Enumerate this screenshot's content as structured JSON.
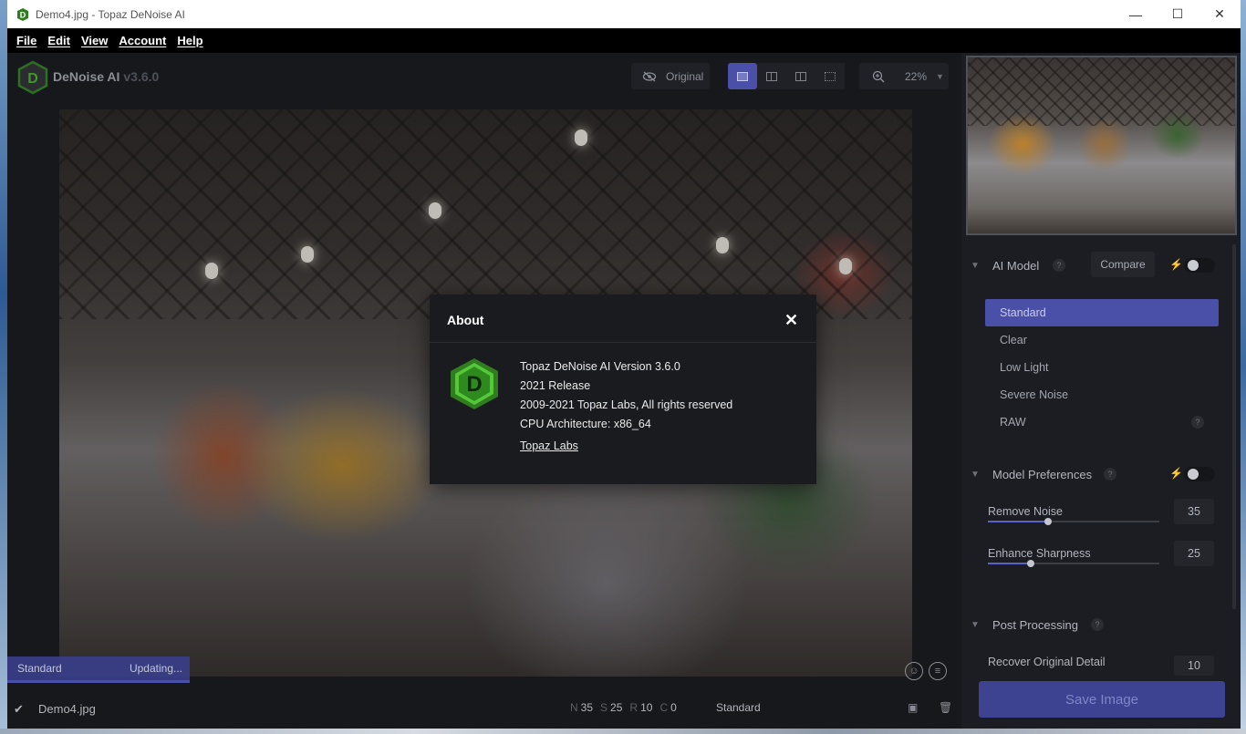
{
  "window": {
    "title": "Demo4.jpg - Topaz DeNoise AI",
    "minimize_glyph": "—",
    "maximize_glyph": "☐",
    "close_glyph": "✕"
  },
  "menu": [
    "File",
    "Edit",
    "View",
    "Account",
    "Help"
  ],
  "app": {
    "name": "DeNoise AI",
    "version": "v3.6.0",
    "logo_letter": "D"
  },
  "toolbar": {
    "original_label": "Original",
    "zoom": "22%"
  },
  "image_status": {
    "model": "Standard",
    "state": "Updating..."
  },
  "bottom": {
    "file": "Demo4.jpg",
    "stats": [
      {
        "key": "N",
        "value": "35"
      },
      {
        "key": "S",
        "value": "25"
      },
      {
        "key": "R",
        "value": "10"
      },
      {
        "key": "C",
        "value": "0"
      }
    ],
    "model": "Standard"
  },
  "panel": {
    "ai_model": {
      "title": "AI Model",
      "compare_label": "Compare",
      "help": "?",
      "models": [
        "Standard",
        "Clear",
        "Low Light",
        "Severe Noise",
        "RAW"
      ],
      "selected": "Standard"
    },
    "model_preferences": {
      "title": "Model Preferences",
      "help": "?",
      "sliders": [
        {
          "label": "Remove Noise",
          "value": "35",
          "fraction": 0.35
        },
        {
          "label": "Enhance Sharpness",
          "value": "25",
          "fraction": 0.25
        }
      ]
    },
    "post_processing": {
      "title": "Post Processing",
      "help": "?",
      "recover_label": "Recover Original Detail",
      "recover_value": "10"
    },
    "save_label": "Save Image"
  },
  "about": {
    "title": "About",
    "lines": [
      "Topaz DeNoise AI Version 3.6.0",
      "2021 Release",
      "2009-2021 Topaz Labs, All rights reserved",
      "CPU Architecture: x86_64"
    ],
    "link": "Topaz Labs",
    "close_glyph": "✕"
  },
  "colors": {
    "accent": "#4a50a8",
    "logo_green": "#3d9a2a",
    "panel_bg": "#1c1d22",
    "main_bg": "#17181c"
  }
}
